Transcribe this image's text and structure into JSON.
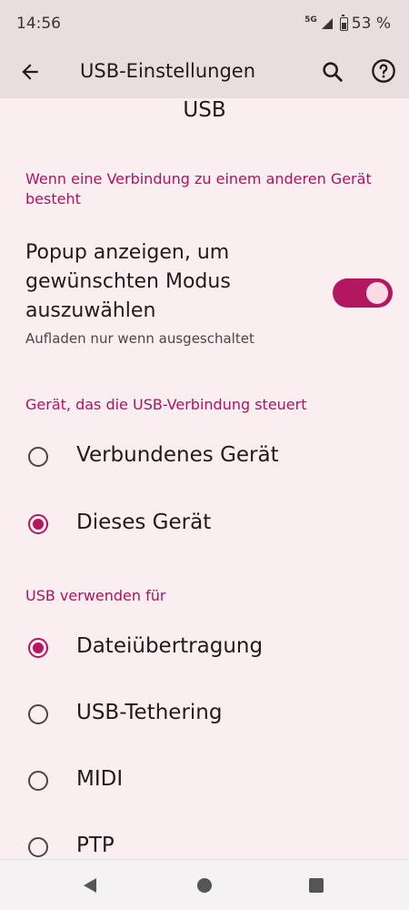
{
  "status_bar": {
    "time": "14:56",
    "network": "5G",
    "battery": "53 %",
    "icons": [
      "signal-icon",
      "battery-icon"
    ]
  },
  "app_bar": {
    "title": "USB-Einstellungen",
    "icons": [
      "back-arrow-icon",
      "search-icon",
      "help-icon"
    ]
  },
  "page": {
    "heading": "USB"
  },
  "connection_section": {
    "header": "Wenn eine Verbindung zu einem anderen Gerät besteht",
    "toggle": {
      "title": "Popup anzeigen, um gewünschten Modus auszuwählen",
      "summary": "Aufladen nur wenn ausgeschaltet",
      "checked": true
    }
  },
  "control_section": {
    "header": "Gerät, das die USB-Verbindung steuert",
    "options": [
      {
        "label": "Verbundenes Gerät",
        "checked": false
      },
      {
        "label": "Dieses Gerät",
        "checked": true
      }
    ]
  },
  "usage_section": {
    "header": "USB verwenden für",
    "options": [
      {
        "label": "Dateiübertragung",
        "checked": true
      },
      {
        "label": "USB-Tethering",
        "checked": false
      },
      {
        "label": "MIDI",
        "checked": false
      },
      {
        "label": "PTP",
        "checked": false
      }
    ]
  },
  "nav_bar": {
    "icons": [
      "nav-back-icon",
      "nav-home-icon",
      "nav-recents-icon"
    ]
  },
  "colors": {
    "accent": "#B3175F",
    "background": "#FBEEF0",
    "bar": "#E8DDDF"
  }
}
